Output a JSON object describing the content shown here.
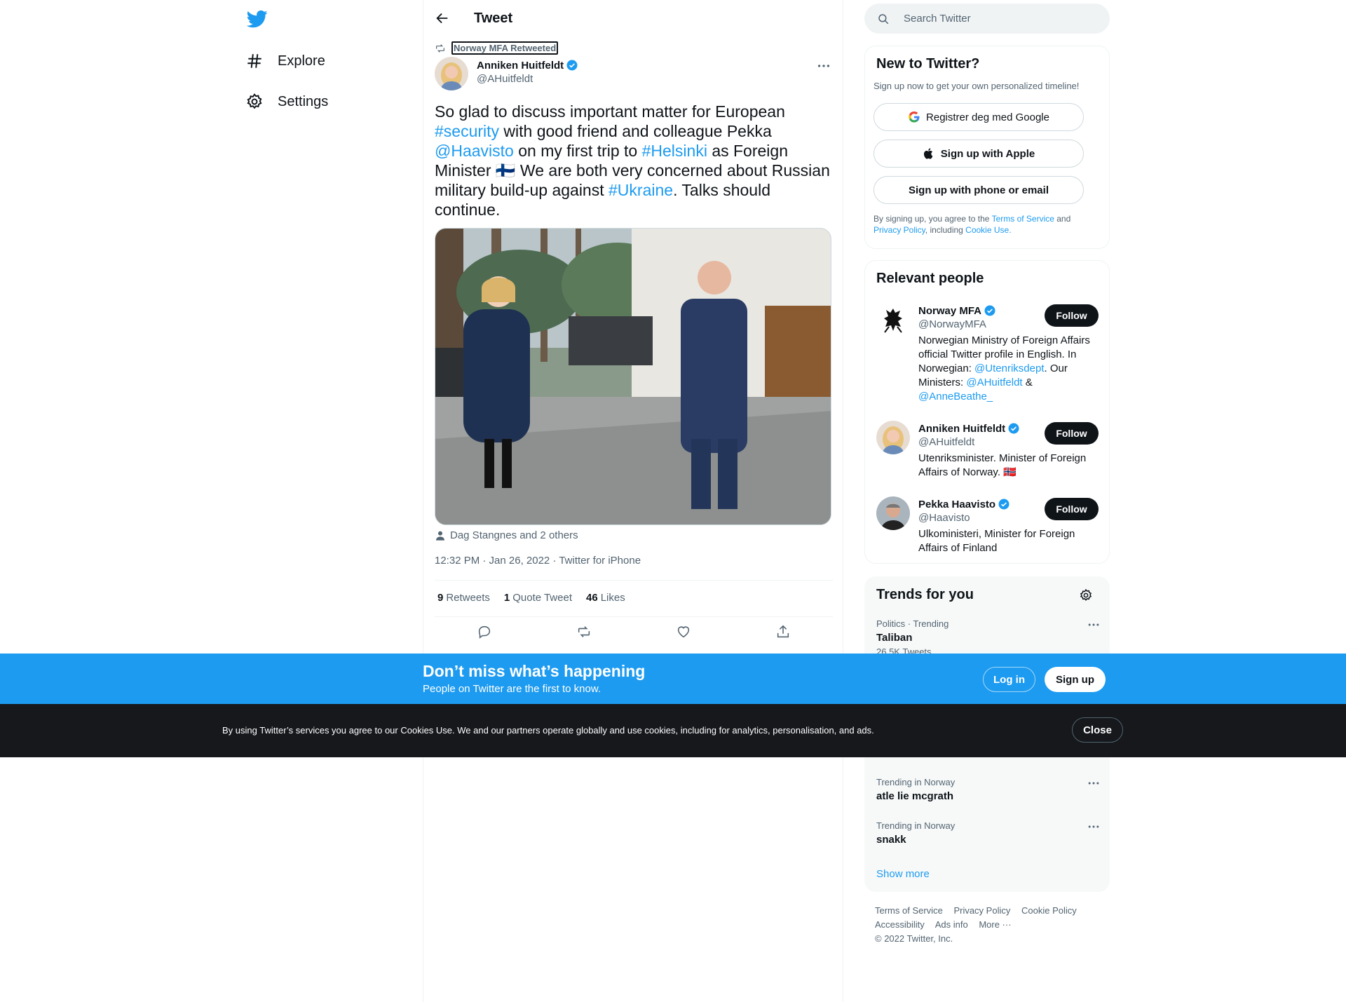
{
  "nav": {
    "items": [
      {
        "label": "Explore",
        "icon": "hashtag-icon"
      },
      {
        "label": "Settings",
        "icon": "gear-icon"
      }
    ]
  },
  "header": {
    "title": "Tweet"
  },
  "tweet": {
    "retweeted_by": "Norway MFA Retweeted",
    "author_name": "Anniken Huitfeldt",
    "author_handle": "@AHuitfeldt",
    "text": {
      "t1": "So glad to discuss important matter for European ",
      "h1": "#security",
      "t2": " with good friend and colleague Pekka ",
      "m1": "@Haavisto",
      "t3": " on my first trip to ",
      "h2": "#Helsinki",
      "t4": " as Foreign Minister ",
      "flag": "🇫🇮",
      "t5": " We are both very concerned about Russian military build-up against ",
      "h3": "#Ukraine",
      "t6": ". Talks should continue."
    },
    "tagged": "Dag Stangnes and 2 others",
    "timestamp": "12:32 PM · Jan 26, 2022 · Twitter for iPhone",
    "stats": {
      "retweets_count": "9",
      "retweets_label": "Retweets",
      "quotes_count": "1",
      "quotes_label": "Quote Tweet",
      "likes_count": "46",
      "likes_label": "Likes"
    }
  },
  "search": {
    "placeholder": "Search Twitter"
  },
  "new_to_twitter": {
    "title": "New to Twitter?",
    "subtitle": "Sign up now to get your own personalized timeline!",
    "google_label": "Registrer deg med Google",
    "apple_label": "Sign up with Apple",
    "phone_label": "Sign up with phone or email",
    "legal": {
      "p1": "By signing up, you agree to the ",
      "tos": "Terms of Service",
      "p2": " and ",
      "privacy": "Privacy Policy",
      "p3": ", including ",
      "cookie": "Cookie Use."
    }
  },
  "relevant": {
    "title": "Relevant people",
    "follow_label": "Follow",
    "people": [
      {
        "name": "Norway MFA",
        "handle": "@NorwayMFA",
        "bio": {
          "t1": "Norwegian Ministry of Foreign Affairs official Twitter profile in English. In Norwegian: ",
          "m1": "@Utenriksdept",
          "t2": ". Our Ministers: ",
          "m2": "@AHuitfeldt",
          "t3": " & ",
          "m3": "@AnneBeathe_"
        }
      },
      {
        "name": "Anniken Huitfeldt",
        "handle": "@AHuitfeldt",
        "bio": "Utenriksminister. Minister of Foreign Affairs of Norway. 🇳🇴"
      },
      {
        "name": "Pekka Haavisto",
        "handle": "@Haavisto",
        "bio": "Ulkoministeri, Minister for Foreign Affairs of Finland"
      }
    ]
  },
  "trends": {
    "title": "Trends for you",
    "items": [
      {
        "meta": "Politics · Trending",
        "name": "Taliban",
        "count": "26.5K Tweets"
      },
      {
        "meta": "Trending in Norway",
        "name": "atle lie mcgrath"
      },
      {
        "meta": "Trending in Norway",
        "name": "snakk"
      }
    ],
    "show_more": "Show more"
  },
  "footer": {
    "links": [
      "Terms of Service",
      "Privacy Policy",
      "Cookie Policy",
      "Accessibility",
      "Ads info",
      "More ···"
    ],
    "copyright": "© 2022 Twitter, Inc."
  },
  "happening": {
    "title": "Don’t miss what’s happening",
    "subtitle": "People on Twitter are the first to know.",
    "login_label": "Log in",
    "signup_label": "Sign up"
  },
  "cookie_banner": {
    "text": "By using Twitter’s services you agree to our Cookies Use. We and our partners operate globally and use cookies, including for analytics, personalisation, and ads.",
    "close_label": "Close"
  },
  "colors": {
    "accent": "#1d9bf0",
    "text": "#0f1419",
    "secondary": "#536471",
    "dark_banner": "#16181c"
  }
}
